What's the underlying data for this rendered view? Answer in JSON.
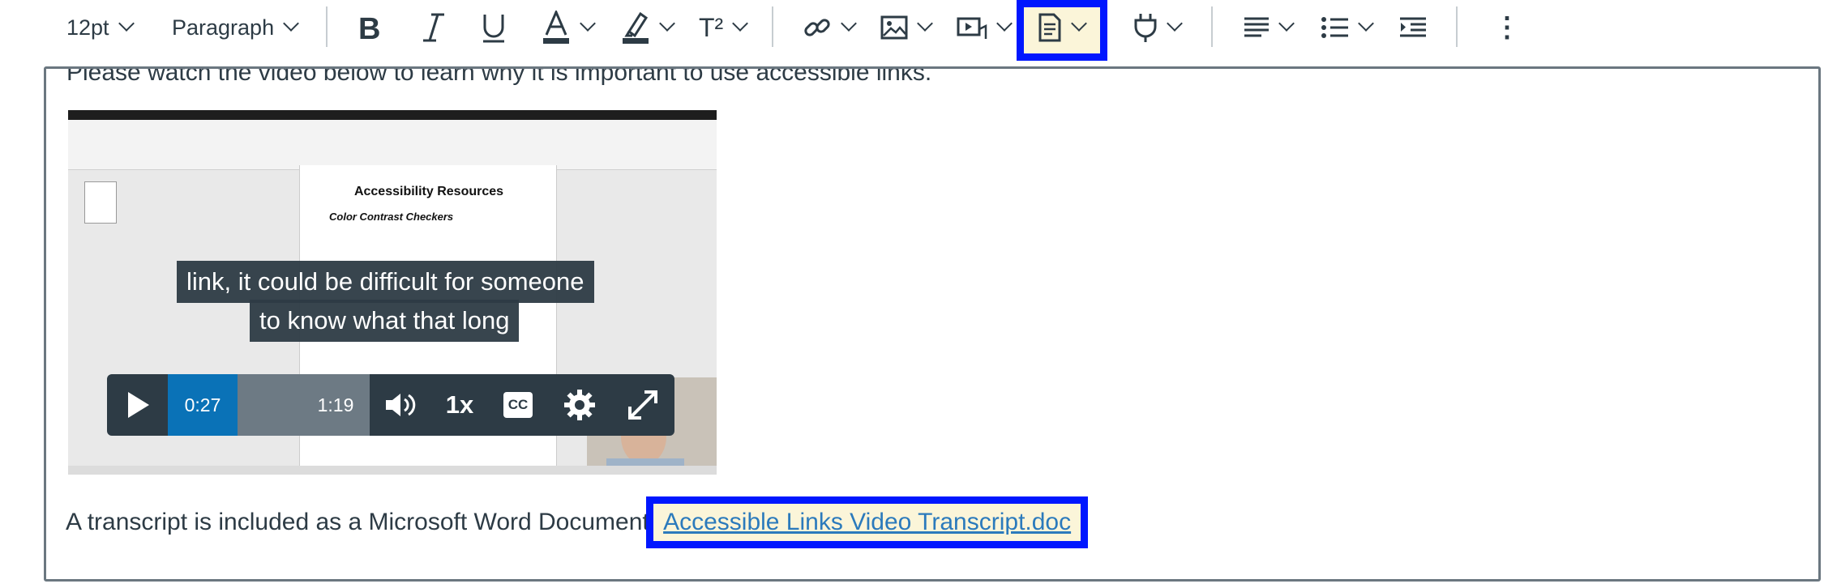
{
  "toolbar": {
    "font_size": "12pt",
    "block_format": "Paragraph",
    "icons": [
      "bold-icon",
      "italic-icon",
      "underline-icon",
      "text-color-icon",
      "highlight-icon",
      "superscript-icon",
      "link-icon",
      "image-icon",
      "media-icon",
      "document-icon",
      "plugin-icon",
      "align-icon",
      "list-icon",
      "indent-icon",
      "more-icon"
    ],
    "superscript_label": "T²",
    "more_label": "⋮"
  },
  "editor": {
    "intro_text": "Please watch the video below to learn why it is important to use accessible links.",
    "transcript_text": "A transcript is included as a Microsoft Word Document ",
    "transcript_link": "Accessible Links Video Transcript.doc"
  },
  "video": {
    "doc_heading": "Accessibility Resources",
    "doc_subheading": "Color Contrast Checkers",
    "caption_line1": "link, it could be difficult for someone",
    "caption_line2": "to know what that long",
    "current_time": "0:27",
    "duration": "1:19",
    "speed": "1x",
    "cc_label": "CC",
    "progress_fraction": 0.34
  },
  "colors": {
    "highlight_border": "#0017ff",
    "highlight_fill": "#fbf5d9",
    "link": "#2b7abc",
    "player_bg": "#2d3b45",
    "progress": "#0a72b7"
  }
}
